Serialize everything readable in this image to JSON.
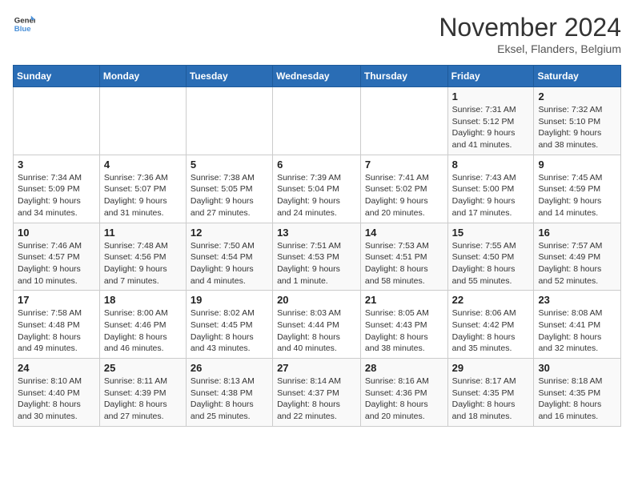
{
  "logo": {
    "line1": "General",
    "line2": "Blue"
  },
  "title": "November 2024",
  "subtitle": "Eksel, Flanders, Belgium",
  "days_header": [
    "Sunday",
    "Monday",
    "Tuesday",
    "Wednesday",
    "Thursday",
    "Friday",
    "Saturday"
  ],
  "weeks": [
    [
      {
        "day": "",
        "info": ""
      },
      {
        "day": "",
        "info": ""
      },
      {
        "day": "",
        "info": ""
      },
      {
        "day": "",
        "info": ""
      },
      {
        "day": "",
        "info": ""
      },
      {
        "day": "1",
        "info": "Sunrise: 7:31 AM\nSunset: 5:12 PM\nDaylight: 9 hours and 41 minutes."
      },
      {
        "day": "2",
        "info": "Sunrise: 7:32 AM\nSunset: 5:10 PM\nDaylight: 9 hours and 38 minutes."
      }
    ],
    [
      {
        "day": "3",
        "info": "Sunrise: 7:34 AM\nSunset: 5:09 PM\nDaylight: 9 hours and 34 minutes."
      },
      {
        "day": "4",
        "info": "Sunrise: 7:36 AM\nSunset: 5:07 PM\nDaylight: 9 hours and 31 minutes."
      },
      {
        "day": "5",
        "info": "Sunrise: 7:38 AM\nSunset: 5:05 PM\nDaylight: 9 hours and 27 minutes."
      },
      {
        "day": "6",
        "info": "Sunrise: 7:39 AM\nSunset: 5:04 PM\nDaylight: 9 hours and 24 minutes."
      },
      {
        "day": "7",
        "info": "Sunrise: 7:41 AM\nSunset: 5:02 PM\nDaylight: 9 hours and 20 minutes."
      },
      {
        "day": "8",
        "info": "Sunrise: 7:43 AM\nSunset: 5:00 PM\nDaylight: 9 hours and 17 minutes."
      },
      {
        "day": "9",
        "info": "Sunrise: 7:45 AM\nSunset: 4:59 PM\nDaylight: 9 hours and 14 minutes."
      }
    ],
    [
      {
        "day": "10",
        "info": "Sunrise: 7:46 AM\nSunset: 4:57 PM\nDaylight: 9 hours and 10 minutes."
      },
      {
        "day": "11",
        "info": "Sunrise: 7:48 AM\nSunset: 4:56 PM\nDaylight: 9 hours and 7 minutes."
      },
      {
        "day": "12",
        "info": "Sunrise: 7:50 AM\nSunset: 4:54 PM\nDaylight: 9 hours and 4 minutes."
      },
      {
        "day": "13",
        "info": "Sunrise: 7:51 AM\nSunset: 4:53 PM\nDaylight: 9 hours and 1 minute."
      },
      {
        "day": "14",
        "info": "Sunrise: 7:53 AM\nSunset: 4:51 PM\nDaylight: 8 hours and 58 minutes."
      },
      {
        "day": "15",
        "info": "Sunrise: 7:55 AM\nSunset: 4:50 PM\nDaylight: 8 hours and 55 minutes."
      },
      {
        "day": "16",
        "info": "Sunrise: 7:57 AM\nSunset: 4:49 PM\nDaylight: 8 hours and 52 minutes."
      }
    ],
    [
      {
        "day": "17",
        "info": "Sunrise: 7:58 AM\nSunset: 4:48 PM\nDaylight: 8 hours and 49 minutes."
      },
      {
        "day": "18",
        "info": "Sunrise: 8:00 AM\nSunset: 4:46 PM\nDaylight: 8 hours and 46 minutes."
      },
      {
        "day": "19",
        "info": "Sunrise: 8:02 AM\nSunset: 4:45 PM\nDaylight: 8 hours and 43 minutes."
      },
      {
        "day": "20",
        "info": "Sunrise: 8:03 AM\nSunset: 4:44 PM\nDaylight: 8 hours and 40 minutes."
      },
      {
        "day": "21",
        "info": "Sunrise: 8:05 AM\nSunset: 4:43 PM\nDaylight: 8 hours and 38 minutes."
      },
      {
        "day": "22",
        "info": "Sunrise: 8:06 AM\nSunset: 4:42 PM\nDaylight: 8 hours and 35 minutes."
      },
      {
        "day": "23",
        "info": "Sunrise: 8:08 AM\nSunset: 4:41 PM\nDaylight: 8 hours and 32 minutes."
      }
    ],
    [
      {
        "day": "24",
        "info": "Sunrise: 8:10 AM\nSunset: 4:40 PM\nDaylight: 8 hours and 30 minutes."
      },
      {
        "day": "25",
        "info": "Sunrise: 8:11 AM\nSunset: 4:39 PM\nDaylight: 8 hours and 27 minutes."
      },
      {
        "day": "26",
        "info": "Sunrise: 8:13 AM\nSunset: 4:38 PM\nDaylight: 8 hours and 25 minutes."
      },
      {
        "day": "27",
        "info": "Sunrise: 8:14 AM\nSunset: 4:37 PM\nDaylight: 8 hours and 22 minutes."
      },
      {
        "day": "28",
        "info": "Sunrise: 8:16 AM\nSunset: 4:36 PM\nDaylight: 8 hours and 20 minutes."
      },
      {
        "day": "29",
        "info": "Sunrise: 8:17 AM\nSunset: 4:35 PM\nDaylight: 8 hours and 18 minutes."
      },
      {
        "day": "30",
        "info": "Sunrise: 8:18 AM\nSunset: 4:35 PM\nDaylight: 8 hours and 16 minutes."
      }
    ]
  ]
}
